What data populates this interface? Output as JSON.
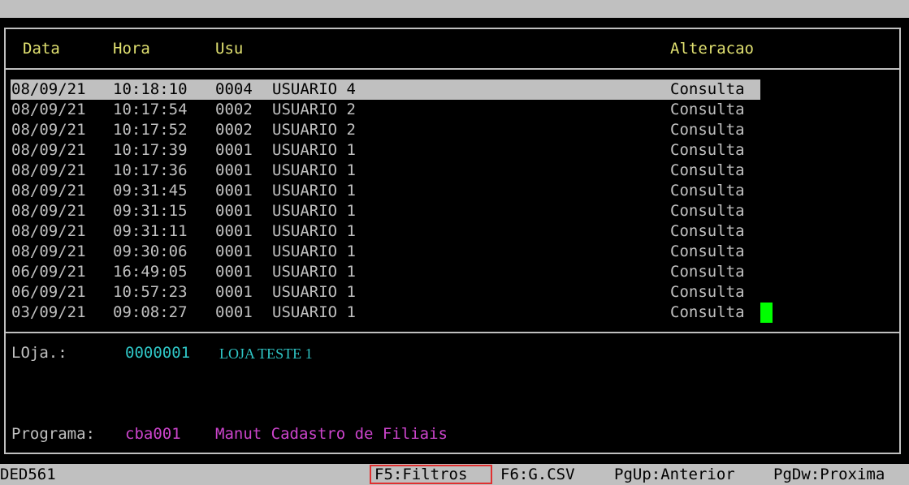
{
  "header": {
    "data": "Data",
    "hora": "Hora",
    "usu": "Usu",
    "alteracao": "Alteracao"
  },
  "rows": [
    {
      "date": "08/09/21",
      "time": "10:18:10",
      "code": "0004",
      "user": "USUARIO 4",
      "change": "Consulta"
    },
    {
      "date": "08/09/21",
      "time": "10:17:54",
      "code": "0002",
      "user": "USUARIO 2",
      "change": "Consulta"
    },
    {
      "date": "08/09/21",
      "time": "10:17:52",
      "code": "0002",
      "user": "USUARIO 2",
      "change": "Consulta"
    },
    {
      "date": "08/09/21",
      "time": "10:17:39",
      "code": "0001",
      "user": "USUARIO 1",
      "change": "Consulta"
    },
    {
      "date": "08/09/21",
      "time": "10:17:36",
      "code": "0001",
      "user": "USUARIO 1",
      "change": "Consulta"
    },
    {
      "date": "08/09/21",
      "time": "09:31:45",
      "code": "0001",
      "user": "USUARIO 1",
      "change": "Consulta"
    },
    {
      "date": "08/09/21",
      "time": "09:31:15",
      "code": "0001",
      "user": "USUARIO 1",
      "change": "Consulta"
    },
    {
      "date": "08/09/21",
      "time": "09:31:11",
      "code": "0001",
      "user": "USUARIO 1",
      "change": "Consulta"
    },
    {
      "date": "08/09/21",
      "time": "09:30:06",
      "code": "0001",
      "user": "USUARIO 1",
      "change": "Consulta"
    },
    {
      "date": "06/09/21",
      "time": "16:49:05",
      "code": "0001",
      "user": "USUARIO 1",
      "change": "Consulta"
    },
    {
      "date": "06/09/21",
      "time": "10:57:23",
      "code": "0001",
      "user": "USUARIO 1",
      "change": "Consulta"
    },
    {
      "date": "03/09/21",
      "time": "09:08:27",
      "code": "0001",
      "user": "USUARIO 1",
      "change": "Consulta"
    }
  ],
  "selected_row": 0,
  "details": {
    "store_label": "LOja.:",
    "store_code": "0000001",
    "store_name": "LOJA TESTE 1",
    "program_label": "Programa:",
    "program_code": "cba001",
    "program_desc": "Manut Cadastro de Filiais"
  },
  "status": {
    "screen_id": "DED561",
    "f5": "F5:Filtros",
    "f6": "F6:G.CSV",
    "pgup": "PgUp:Anterior",
    "pgdw": "PgDw:Proxima"
  },
  "colors": {
    "background": "#000000",
    "header_text": "#e0e070",
    "list_text": "#c0c0c0",
    "highlight_bar": "#c0c0c0",
    "cursor": "#00ff00",
    "store_code": "#2fc6c6",
    "program": "#cc44cc",
    "f5_highlight_box": "#e03030"
  }
}
